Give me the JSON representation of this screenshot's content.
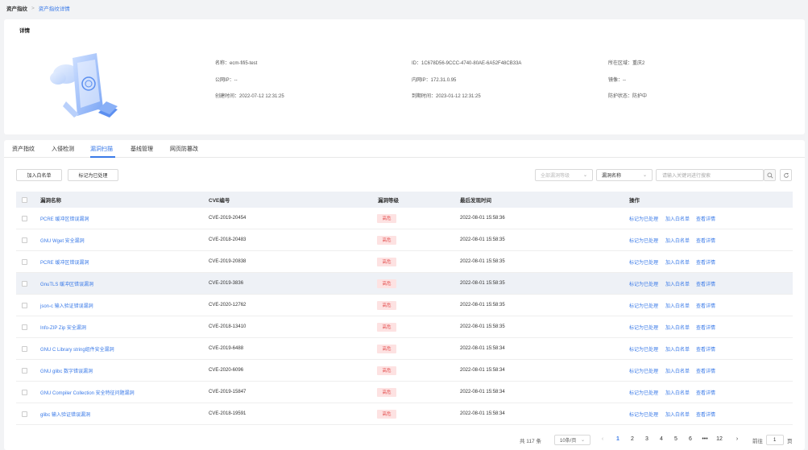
{
  "breadcrumb": {
    "home": "资产指纹",
    "sep": ">",
    "current": "资产指纹详情"
  },
  "detail": {
    "title": "详情",
    "name": "名称：ecm-fifi5-test",
    "public_ip": "公网IP：--",
    "created": "创建时间：2022-07-12 12:31:25",
    "id": "ID：1C678D56-9CCC-4740-80AE-6A52F48CB33A",
    "private_ip": "内网IP：172.31.0.95",
    "expire": "到期时间：2023-01-12 12:31:25",
    "region": "所在区域：重庆2",
    "image": "镜像：--",
    "protect": "防护状态：防护中"
  },
  "tabs": [
    "资产指纹",
    "入侵检测",
    "漏洞扫描",
    "基线管理",
    "网页防篡改"
  ],
  "toolbar": {
    "whitelist_btn": "加入白名单",
    "mark_btn": "标记为已处理",
    "level_placeholder": "全部漏洞等级",
    "field_select": "漏洞名称",
    "search_placeholder": "请输入关键词进行搜索"
  },
  "table": {
    "headers": [
      "漏洞名称",
      "CVE编号",
      "漏洞等级",
      "最后发现时间",
      "操作"
    ],
    "rows": [
      {
        "name": "PCRE 缓冲区错误漏洞",
        "cve": "CVE-2019-20454",
        "level": "高危",
        "time": "2022-08-01 15:58:36"
      },
      {
        "name": "GNU Wget 安全漏洞",
        "cve": "CVE-2018-20483",
        "level": "高危",
        "time": "2022-08-01 15:58:35"
      },
      {
        "name": "PCRE 缓冲区错误漏洞",
        "cve": "CVE-2019-20838",
        "level": "高危",
        "time": "2022-08-01 15:58:35"
      },
      {
        "name": "GnuTLS 缓冲区错误漏洞",
        "cve": "CVE-2019-3836",
        "level": "高危",
        "time": "2022-08-01 15:58:35"
      },
      {
        "name": "json-c 输入验证错误漏洞",
        "cve": "CVE-2020-12762",
        "level": "高危",
        "time": "2022-08-01 15:58:35"
      },
      {
        "name": "Info-ZIP Zip 安全漏洞",
        "cve": "CVE-2018-13410",
        "level": "高危",
        "time": "2022-08-01 15:58:35"
      },
      {
        "name": "GNU C Library string组件安全漏洞",
        "cve": "CVE-2019-6488",
        "level": "高危",
        "time": "2022-08-01 15:58:34"
      },
      {
        "name": "GNU glibc 数字错误漏洞",
        "cve": "CVE-2020-6096",
        "level": "高危",
        "time": "2022-08-01 15:58:34"
      },
      {
        "name": "GNU Compiler Collection 安全特征问题漏洞",
        "cve": "CVE-2019-15847",
        "level": "高危",
        "time": "2022-08-01 15:58:34"
      },
      {
        "name": "glibc 输入验证错误漏洞",
        "cve": "CVE-2018-19591",
        "level": "高危",
        "time": "2022-08-01 15:58:34"
      }
    ],
    "ops": [
      "标记为已处理",
      "加入白名单",
      "查看详情"
    ]
  },
  "pager": {
    "total": "共 117 条",
    "page_size": "10条/页",
    "pages": [
      "1",
      "2",
      "3",
      "4",
      "5",
      "6",
      "•••",
      "12"
    ],
    "goto_label": "前往",
    "goto_value": "1",
    "page_unit": "页"
  },
  "colors": {
    "accent": "#3a7ae8",
    "danger": "#e34d4d",
    "danger_bg": "#fde2e2"
  }
}
